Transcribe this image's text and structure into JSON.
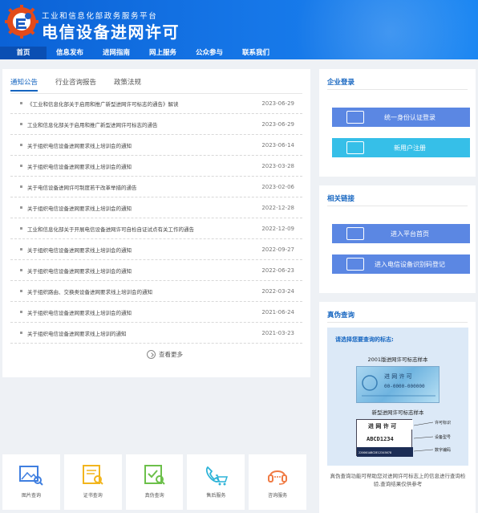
{
  "header": {
    "subtitle": "工业和信息化部政务服务平台",
    "title": "电信设备进网许可"
  },
  "nav": [
    "首页",
    "信息发布",
    "进网指南",
    "网上服务",
    "公众参与",
    "联系我们"
  ],
  "news": {
    "tabs": [
      "通知公告",
      "行业咨询报告",
      "政策法规"
    ],
    "items": [
      {
        "title": "《工业和信息化部关于启用和推广新型进网许可标志的通告》解读",
        "date": "2023-06-29"
      },
      {
        "title": "工业和信息化部关于启用和推广新型进网许可标志的通告",
        "date": "2023-06-29"
      },
      {
        "title": "关于组织电信设备进网要求线上培训会的通知",
        "date": "2023-06-14"
      },
      {
        "title": "关于组织电信设备进网要求线上培训会的通知",
        "date": "2023-03-28"
      },
      {
        "title": "关于电信设备进网许可制度若干改革举措的通告",
        "date": "2023-02-06"
      },
      {
        "title": "关于组织电信设备进网要求线上培训会的通知",
        "date": "2022-12-28"
      },
      {
        "title": "工业和信息化部关于开展电信设备进网许可自检自证试点有关工作的通告",
        "date": "2022-12-09"
      },
      {
        "title": "关于组织电信设备进网要求线上培训会的通知",
        "date": "2022-09-27"
      },
      {
        "title": "关于组织电信设备进网要求线上培训会的通知",
        "date": "2022-06-23"
      },
      {
        "title": "关于组织路由、交换类设备进网要求线上培训会的通知",
        "date": "2022-03-24"
      },
      {
        "title": "关于组织电信设备进网要求线上培训会的通知",
        "date": "2021-06-24"
      },
      {
        "title": "关于组织电信设备进网要求线上培训的通知",
        "date": "2021-03-23"
      }
    ],
    "more": "查看更多"
  },
  "login": {
    "title": "企业登录",
    "buttons": [
      "统一身份认证登录",
      "新用户注册"
    ]
  },
  "links": {
    "title": "相关链接",
    "buttons": [
      "进入平台首页",
      "进入电信设备识别码登记"
    ]
  },
  "verify": {
    "title": "真伪查询",
    "prompt": "请选择您要查询的标志:",
    "old_caption": "2001版进网许可标志样本",
    "new_caption": "新型进网许可标志样本",
    "old_label_text": "进 网 许 可",
    "old_label_num": "00-0000-000000",
    "new_label_text": "进 网 许 可",
    "new_label_code": "ABCD1234",
    "new_label_serial": "220001ABCDE12345678",
    "annot": [
      "许可标识",
      "设备型号",
      "数字编码"
    ],
    "note": "真伪查询功能可帮助您对进网许可标志上的信息进行查询检验,查询结果仅供参考"
  },
  "services": [
    "图片查询",
    "证书查询",
    "真伪查询",
    "售后服务",
    "咨询服务"
  ],
  "colors": {
    "primary": "#1565c0",
    "header": "#1677e8",
    "button_blue": "#5b87e3",
    "button_cyan": "#36bfe8"
  }
}
